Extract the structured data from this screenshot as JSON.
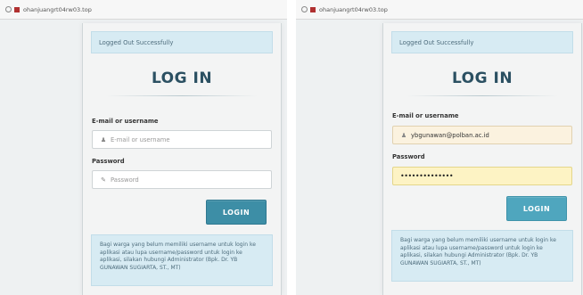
{
  "screenshots": [
    {
      "address_bar": "ohanjuangrt04rw03.top",
      "alert": "Logged Out Successfully",
      "title": "LOG IN",
      "username_label": "E-mail or username",
      "username_placeholder": "E-mail or username",
      "username_value": "",
      "password_label": "Password",
      "password_placeholder": "Password",
      "password_value": "",
      "login_button": "LOGIN",
      "info": "Bagi warga yang belum memiliki username untuk login ke aplikasi atau lupa username/password untuk login ke aplikasi, silakan hubungi Administrator (Bpk. Dr. YB GUNAWAN SUGIARTA, ST., MT)"
    },
    {
      "address_bar": "ohanjuangrt04rw03.top",
      "alert": "Logged Out Successfully",
      "title": "LOG IN",
      "username_label": "E-mail or username",
      "username_placeholder": "",
      "username_value": "ybgunawan@polban.ac.id",
      "password_label": "Password",
      "password_placeholder": "",
      "password_value": "••••••••••••••",
      "login_button": "LOGIN",
      "info": "Bagi warga yang belum memiliki username untuk login ke aplikasi atau lupa username/password untuk login ke aplikasi, silakan hubungi Administrator (Bpk. Dr. YB GUNAWAN SUGIARTA, ST., MT)"
    }
  ],
  "icons": {
    "info": "info-icon",
    "lock": "lock-icon",
    "user": "user-icon",
    "pencil": "pencil-icon"
  },
  "colors": {
    "alert_bg": "#d7ebf3",
    "button_bg": "#3d8ea6",
    "title": "#2b5062",
    "autofill_username": "#fbf2df",
    "autofill_password": "#fdf3c4"
  }
}
